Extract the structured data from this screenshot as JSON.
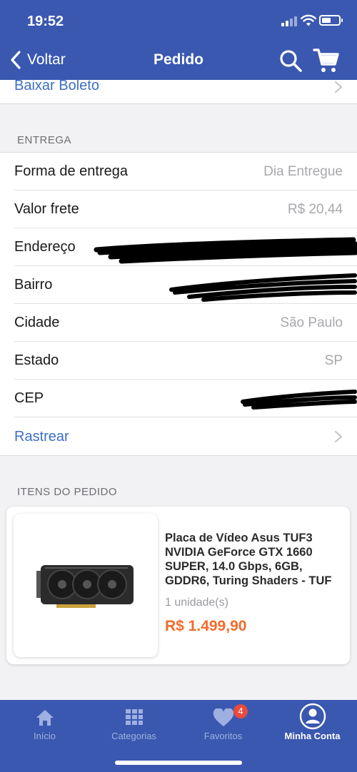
{
  "status_bar": {
    "time": "19:52"
  },
  "nav": {
    "back_label": "Voltar",
    "title": "Pedido"
  },
  "boleto": {
    "label": "Baixar Boleto"
  },
  "delivery": {
    "section_title": "ENTREGA",
    "rows": [
      {
        "label": "Forma de entrega",
        "value": "Dia Entregue"
      },
      {
        "label": "Valor frete",
        "value": "R$ 20,44"
      },
      {
        "label": "Endereço",
        "value": ""
      },
      {
        "label": "Bairro",
        "value": ""
      },
      {
        "label": "Cidade",
        "value": "São Paulo"
      },
      {
        "label": "Estado",
        "value": "SP"
      },
      {
        "label": "CEP",
        "value": ""
      }
    ],
    "track_label": "Rastrear"
  },
  "items": {
    "section_title": "ITENS DO PEDIDO",
    "product": {
      "name": "Placa de Vídeo Asus TUF3 NVIDIA GeForce GTX 1660 SUPER, 14.0 Gbps, 6GB, GDDR6, Turing Shaders - TUF",
      "quantity": "1 unidade(s)",
      "price": "R$ 1.499,90"
    }
  },
  "tabbar": {
    "tabs": [
      {
        "label": "Início",
        "icon": "home-icon"
      },
      {
        "label": "Categorias",
        "icon": "grid-icon"
      },
      {
        "label": "Favoritos",
        "icon": "heart-icon",
        "badge": "4"
      },
      {
        "label": "Minha Conta",
        "icon": "user-icon"
      }
    ],
    "active_tab": "Minha Conta"
  },
  "colors": {
    "primary": "#3a58b0",
    "link": "#3d6fc4",
    "price": "#f26b2d",
    "badge": "#e84a3d"
  }
}
